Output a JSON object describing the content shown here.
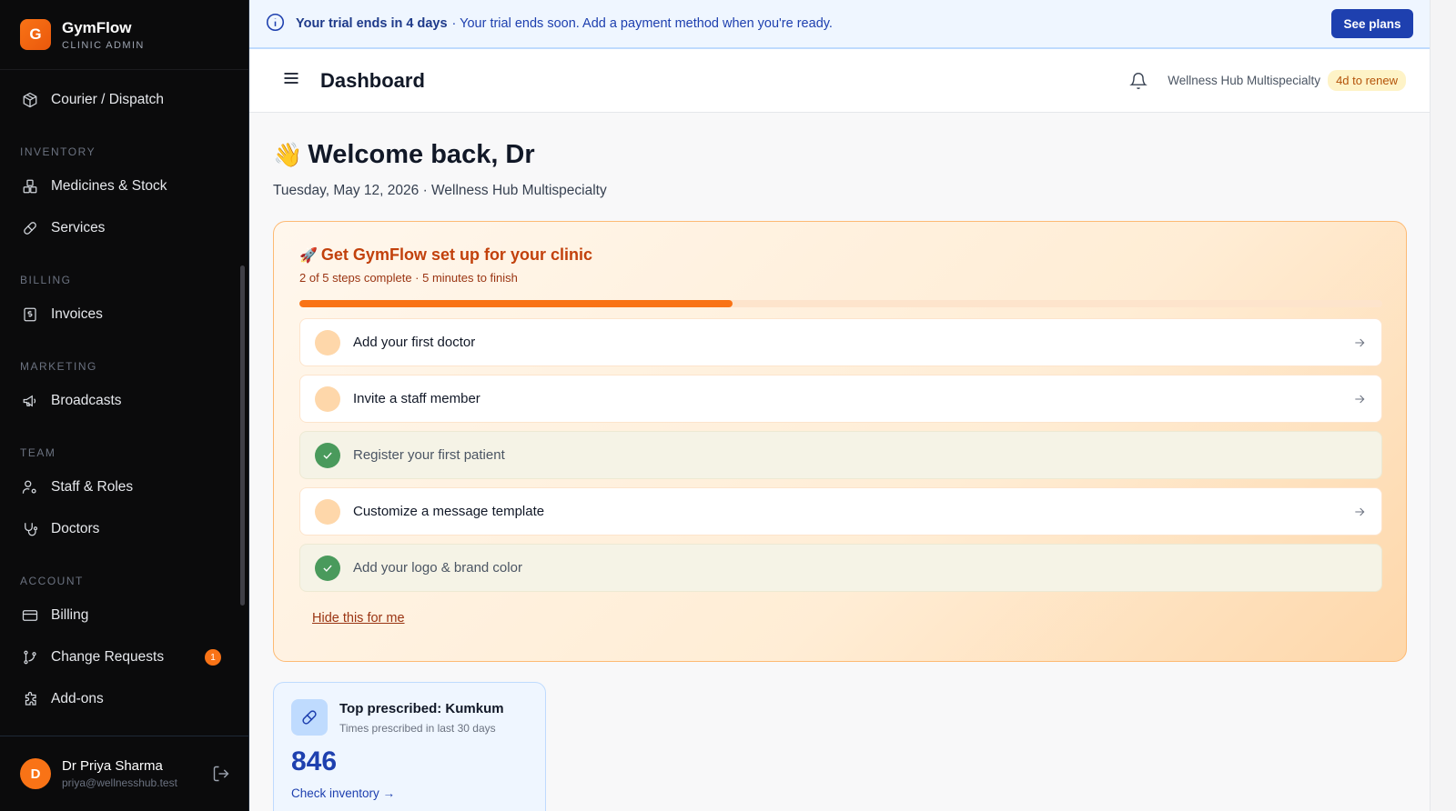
{
  "brand": {
    "logo_letter": "G",
    "name": "GymFlow",
    "subtitle": "CLINIC ADMIN"
  },
  "sidebar": {
    "items": [
      {
        "label": "Courier / Dispatch",
        "icon": "package-icon"
      },
      {
        "section": "INVENTORY"
      },
      {
        "label": "Medicines & Stock",
        "icon": "boxes-icon"
      },
      {
        "label": "Services",
        "icon": "pill-icon"
      },
      {
        "section": "BILLING"
      },
      {
        "label": "Invoices",
        "icon": "receipt-icon"
      },
      {
        "section": "MARKETING"
      },
      {
        "label": "Broadcasts",
        "icon": "megaphone-icon"
      },
      {
        "section": "TEAM"
      },
      {
        "label": "Staff & Roles",
        "icon": "user-cog-icon"
      },
      {
        "label": "Doctors",
        "icon": "stethoscope-icon"
      },
      {
        "section": "ACCOUNT"
      },
      {
        "label": "Billing",
        "icon": "credit-card-icon"
      },
      {
        "label": "Change Requests",
        "icon": "git-branch-icon",
        "badge": "1"
      },
      {
        "label": "Add-ons",
        "icon": "puzzle-icon"
      }
    ],
    "user": {
      "avatar_letter": "D",
      "name": "Dr Priya Sharma",
      "email": "priya@wellnesshub.test"
    }
  },
  "trial_banner": {
    "strong": "Your trial ends in 4 days",
    "rest": "· Your trial ends soon. Add a payment method when you're ready.",
    "button": "See plans"
  },
  "topbar": {
    "title": "Dashboard",
    "clinic": "Wellness Hub Multispecialty",
    "renew_badge": "4d to renew"
  },
  "welcome": {
    "emoji": "👋",
    "heading": "Welcome back, Dr",
    "date_line": "Tuesday, May 12, 2026 · Wellness Hub Multispecialty"
  },
  "setup": {
    "emoji": "🚀",
    "title": "Get GymFlow set up for your clinic",
    "subtitle": "2 of 5 steps complete · 5 minutes to finish",
    "progress_fraction": 0.4,
    "steps": [
      {
        "label": "Add your first doctor",
        "done": false
      },
      {
        "label": "Invite a staff member",
        "done": false
      },
      {
        "label": "Register your first patient",
        "done": true
      },
      {
        "label": "Customize a message template",
        "done": false
      },
      {
        "label": "Add your logo & brand color",
        "done": true
      }
    ],
    "hide_link": "Hide this for me"
  },
  "stat_card": {
    "title": "Top prescribed: Kumkum",
    "subtitle": "Times prescribed in last 30 days",
    "value": "846",
    "link": "Check inventory →"
  },
  "colors": {
    "accent": "#f97316",
    "primary_blue": "#1e40af",
    "sidebar_bg": "#0b0b0c"
  }
}
